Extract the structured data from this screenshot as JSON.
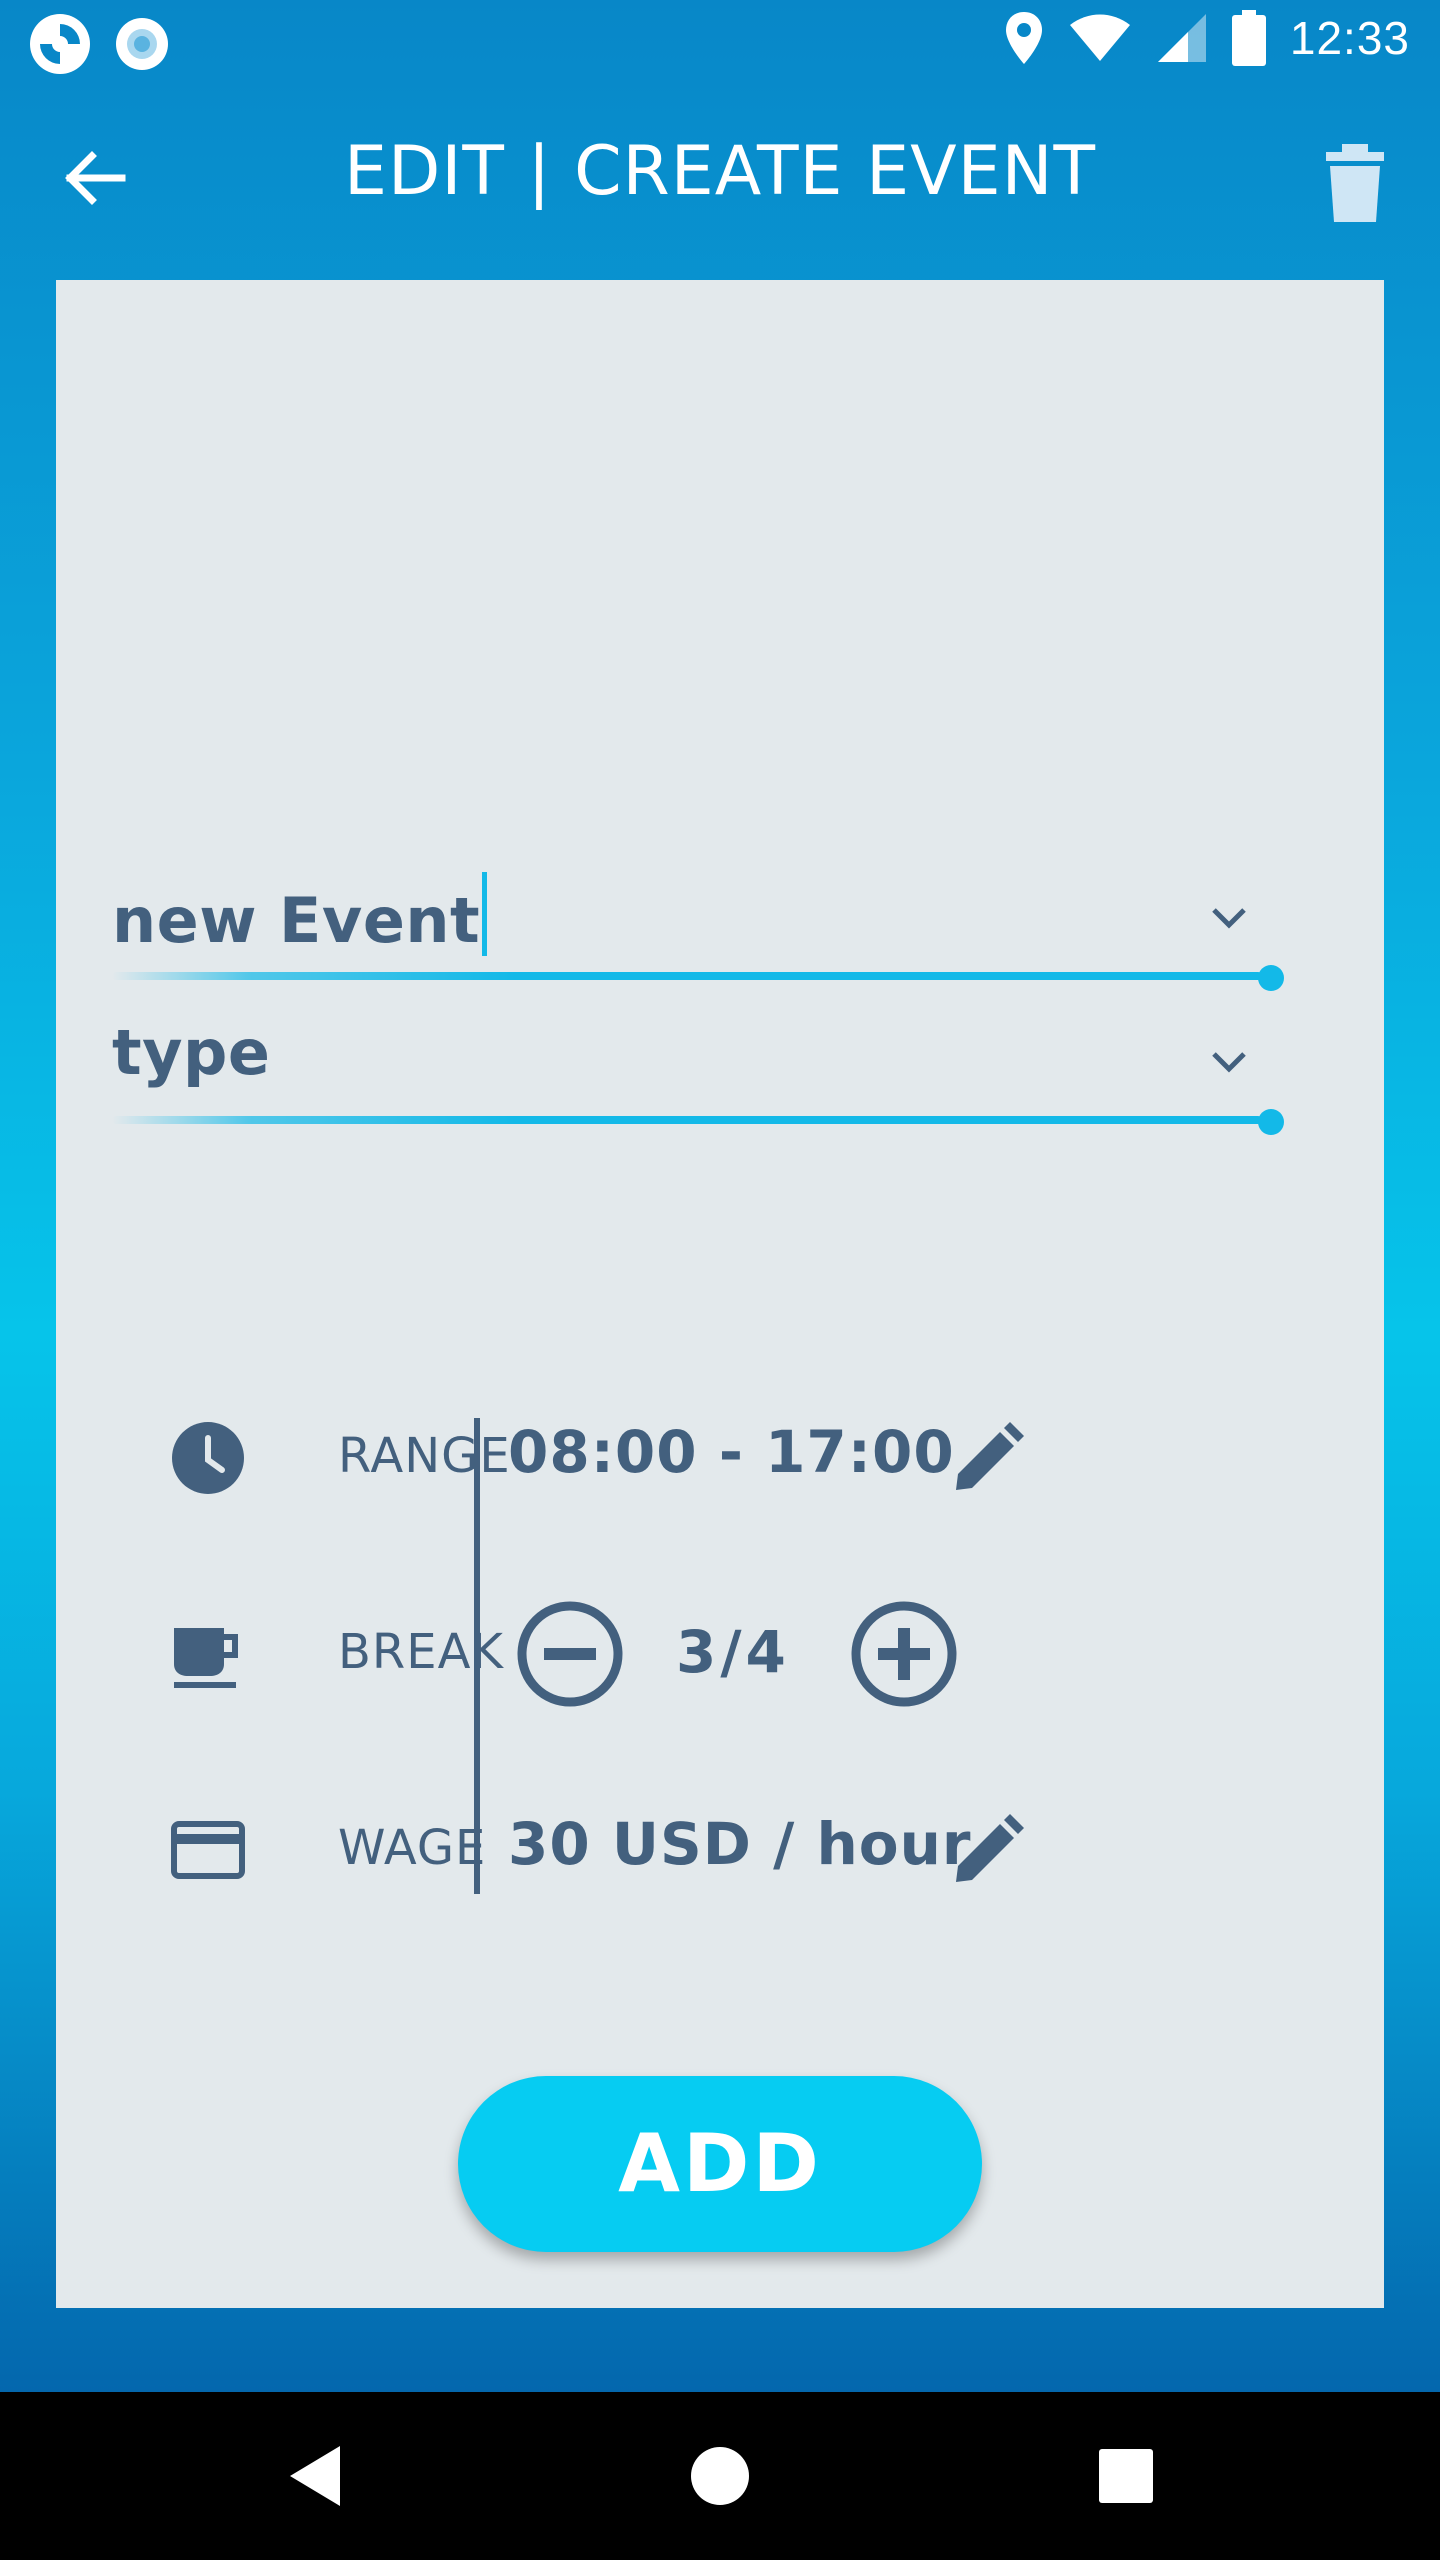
{
  "status_bar": {
    "time": "12:33",
    "icons": [
      "app-logo-icon",
      "record-icon",
      "location-icon",
      "wifi-icon",
      "signal-icon",
      "battery-icon"
    ]
  },
  "app_bar": {
    "title": "EDIT | CREATE EVENT",
    "back_icon": "arrow-left-icon",
    "delete_icon": "trash-icon"
  },
  "form": {
    "name_field": {
      "value": "new Event"
    },
    "type_field": {
      "value": "type"
    }
  },
  "details": {
    "range": {
      "label": "RANGE",
      "value": "08:00 - 17:00"
    },
    "break": {
      "label": "BREAK",
      "value": "3/4"
    },
    "wage": {
      "label": "WAGE",
      "value": "30 USD / hour"
    }
  },
  "add_button": {
    "label": "ADD"
  },
  "colors": {
    "accent": "#13b9e8",
    "text": "#43607e",
    "card": "#e3e9ec",
    "button": "#06ccf2"
  }
}
